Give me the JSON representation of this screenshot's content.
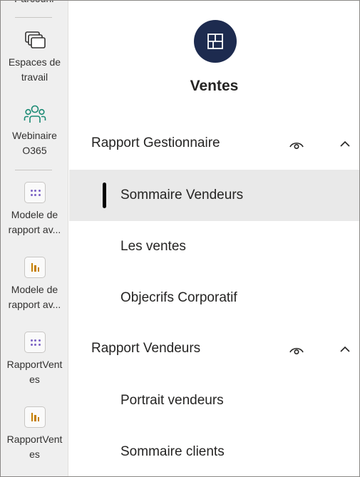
{
  "rail": {
    "items": [
      {
        "label": "Parcourir",
        "icon": "browse-icon"
      },
      {
        "label": "Espaces de travail",
        "line1": "Espaces de",
        "line2": "travail",
        "icon": "workspaces-icon"
      },
      {
        "label": "Webinaire O365",
        "line1": "Webinaire",
        "line2": "O365",
        "icon": "people-icon"
      },
      {
        "label": "Modele de rapport av...",
        "line1": "Modele de",
        "line2": "rapport av...",
        "icon": "dot-grid-icon"
      },
      {
        "label": "Modele de rapport av...",
        "line1": "Modele de",
        "line2": "rapport av...",
        "icon": "bar-chart-icon"
      },
      {
        "label": "RapportVentes",
        "line1": "RapportVent",
        "line2": "es",
        "icon": "dot-grid-icon"
      },
      {
        "label": "RapportVentes",
        "line1": "RapportVent",
        "line2": "es",
        "icon": "bar-chart-icon"
      }
    ]
  },
  "app": {
    "title": "Ventes",
    "logo_color": "#1d2b4f"
  },
  "sections": [
    {
      "title": "Rapport Gestionnaire",
      "pages": [
        "Sommaire Vendeurs",
        "Les ventes",
        "Objecrifs Corporatif"
      ],
      "active_page": "Sommaire Vendeurs"
    },
    {
      "title": "Rapport Vendeurs",
      "pages": [
        "Portrait vendeurs",
        "Sommaire clients"
      ]
    }
  ],
  "colors": {
    "rail_bg": "#efefef",
    "active_bg": "#e9e9e9",
    "people_icon": "#1a8a74",
    "dot_icon": "#7b61c4",
    "bar_icon": "#c47f00"
  }
}
